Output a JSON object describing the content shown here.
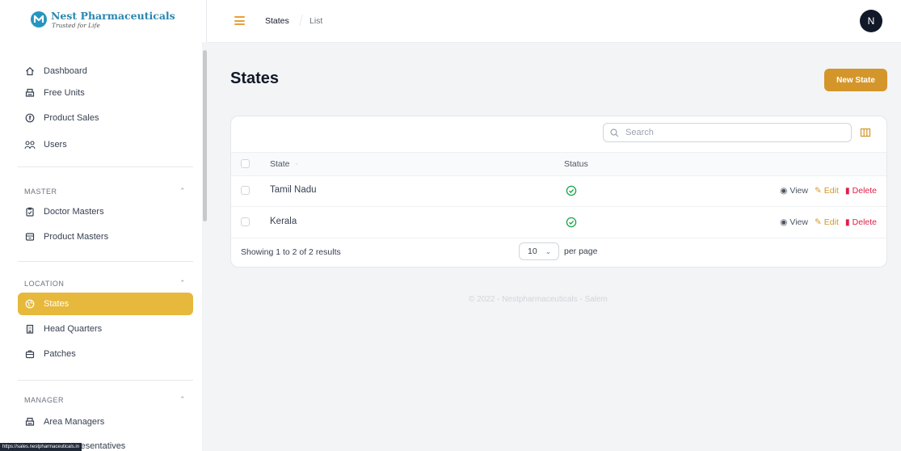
{
  "brand": {
    "name": "Nest Pharmaceuticals",
    "tagline": "Trusted for Life"
  },
  "sidebar": {
    "main_items": [
      {
        "label": "Dashboard",
        "icon": "home-icon"
      },
      {
        "label": "Free Units",
        "icon": "printer-icon"
      },
      {
        "label": "Product Sales",
        "icon": "coin-icon"
      },
      {
        "label": "Users",
        "icon": "users-icon"
      }
    ],
    "sections": [
      {
        "label": "MASTER",
        "items": [
          {
            "label": "Doctor Masters",
            "icon": "clipboard-icon"
          },
          {
            "label": "Product Masters",
            "icon": "archive-icon"
          }
        ]
      },
      {
        "label": "LOCATION",
        "items": [
          {
            "label": "States",
            "icon": "globe-icon",
            "active": true
          },
          {
            "label": "Head Quarters",
            "icon": "building-icon"
          },
          {
            "label": "Patches",
            "icon": "briefcase-icon"
          }
        ]
      },
      {
        "label": "MANAGER",
        "items": [
          {
            "label": "Area Managers",
            "icon": "printer-icon"
          },
          {
            "label": "resentatives",
            "icon": "printer-icon"
          }
        ]
      }
    ],
    "status_url": "https://sales.nestpharmaceuticals.in"
  },
  "topbar": {
    "breadcrumb": [
      "States",
      "List"
    ],
    "avatar_initial": "N"
  },
  "page": {
    "title": "States",
    "new_button": "New State"
  },
  "table": {
    "search_placeholder": "Search",
    "columns": [
      "State",
      "Status"
    ],
    "rows": [
      {
        "state": "Tamil Nadu",
        "status": "active"
      },
      {
        "state": "Kerala",
        "status": "active"
      }
    ],
    "actions": [
      "View",
      "Edit",
      "Delete"
    ],
    "showing": "Showing 1 to 2 of 2 results",
    "per_page_value": "10",
    "per_page_label": "per page"
  },
  "footer": {
    "copyright": "© 2022 - Nestpharmaceuticals - Salem"
  },
  "colors": {
    "accent": "#e6b83c",
    "button": "#d4962a",
    "success": "#16a34a",
    "danger": "#e11d48"
  }
}
